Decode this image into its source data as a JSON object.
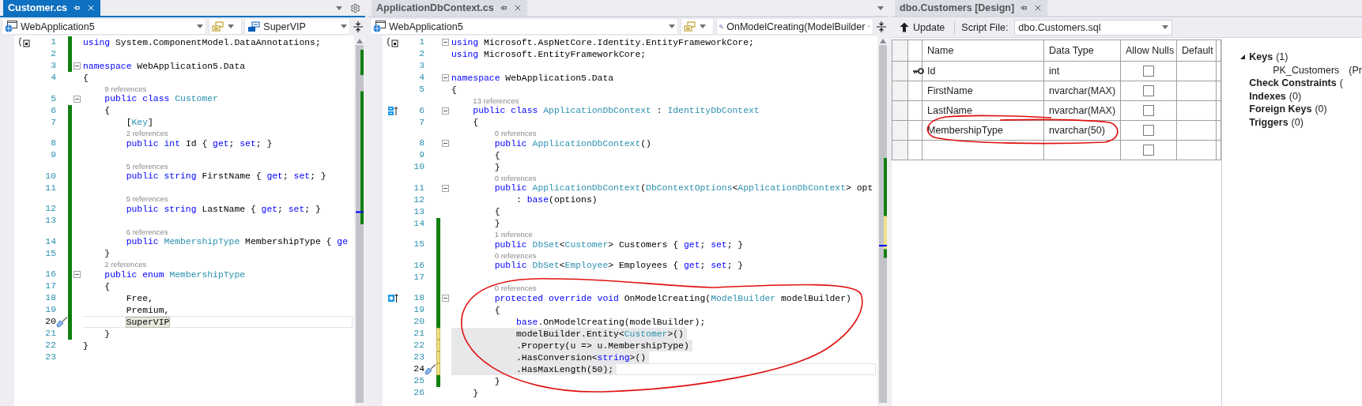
{
  "panels": [
    {
      "kind": "code",
      "tab": {
        "label": "Customer.cs",
        "selected": true
      },
      "nav": {
        "project": "WebApplication5",
        "member": {
          "text": "SuperVIP",
          "kind": "enum-value"
        }
      },
      "lines": [
        {
          "n": "1",
          "margin_icon": {
            "kind": "scope"
          },
          "changed": true,
          "saved": true,
          "code": [
            {
              "kind": "keyword",
              "text": "using"
            },
            {
              "kind": "plain",
              "text": " System.ComponentModel.DataAnnotations;"
            }
          ]
        },
        {
          "n": "2",
          "changed": true,
          "saved": true
        },
        {
          "n": "3",
          "changed": true,
          "saved": true,
          "fold": true,
          "code": [
            {
              "kind": "keyword",
              "text": "namespace"
            },
            {
              "kind": "plain",
              "text": " WebApplication5.Data"
            }
          ]
        },
        {
          "n": "4",
          "changed": false,
          "code": [
            {
              "kind": "plain",
              "text": "{"
            }
          ]
        },
        {
          "n": "5",
          "changed": false,
          "lens": "9 references",
          "fold": true,
          "code": [
            {
              "kind": "keyword",
              "text": "    public class "
            },
            {
              "kind": "type",
              "text": "Customer"
            }
          ]
        },
        {
          "n": "6",
          "changed": true,
          "saved": true,
          "code": [
            {
              "kind": "plain",
              "text": "    {"
            }
          ]
        },
        {
          "n": "7",
          "changed": true,
          "saved": true,
          "code": [
            {
              "kind": "plain",
              "text": "        ["
            },
            {
              "kind": "type",
              "text": "Key"
            },
            {
              "kind": "plain",
              "text": "]"
            }
          ]
        },
        {
          "n": "8",
          "changed": true,
          "saved": true,
          "lens": "2 references",
          "code": [
            {
              "kind": "keyword",
              "text": "        public int"
            },
            {
              "kind": "plain",
              "text": " Id { "
            },
            {
              "kind": "keyword",
              "text": "get"
            },
            {
              "kind": "plain",
              "text": "; "
            },
            {
              "kind": "keyword",
              "text": "set"
            },
            {
              "kind": "plain",
              "text": "; }"
            }
          ]
        },
        {
          "n": "9",
          "changed": true,
          "saved": true
        },
        {
          "n": "10",
          "changed": true,
          "saved": true,
          "lens": "5 references",
          "code": [
            {
              "kind": "keyword",
              "text": "        public string"
            },
            {
              "kind": "plain",
              "text": " FirstName { "
            },
            {
              "kind": "keyword",
              "text": "get"
            },
            {
              "kind": "plain",
              "text": "; "
            },
            {
              "kind": "keyword",
              "text": "set"
            },
            {
              "kind": "plain",
              "text": "; }"
            }
          ]
        },
        {
          "n": "11",
          "changed": true,
          "saved": true
        },
        {
          "n": "12",
          "changed": true,
          "saved": true,
          "lens": "5 references",
          "code": [
            {
              "kind": "keyword",
              "text": "        public string"
            },
            {
              "kind": "plain",
              "text": " LastName { "
            },
            {
              "kind": "keyword",
              "text": "get"
            },
            {
              "kind": "plain",
              "text": "; "
            },
            {
              "kind": "keyword",
              "text": "set"
            },
            {
              "kind": "plain",
              "text": "; }"
            }
          ]
        },
        {
          "n": "13",
          "changed": true,
          "saved": true
        },
        {
          "n": "14",
          "changed": true,
          "saved": true,
          "lens": "6 references",
          "code": [
            {
              "kind": "keyword",
              "text": "        public "
            },
            {
              "kind": "type",
              "text": "MembershipType"
            },
            {
              "kind": "plain",
              "text": " MembershipType { "
            },
            {
              "kind": "keyword",
              "text": "ge"
            }
          ]
        },
        {
          "n": "15",
          "changed": true,
          "saved": true,
          "code": [
            {
              "kind": "plain",
              "text": "    }"
            }
          ]
        },
        {
          "n": "16",
          "changed": true,
          "saved": true,
          "lens": "2 references",
          "fold": true,
          "code": [
            {
              "kind": "keyword",
              "text": "    public enum "
            },
            {
              "kind": "type",
              "text": "MembershipType"
            }
          ]
        },
        {
          "n": "17",
          "changed": true,
          "saved": true,
          "code": [
            {
              "kind": "plain",
              "text": "    {"
            }
          ]
        },
        {
          "n": "18",
          "changed": true,
          "saved": true,
          "code": [
            {
              "kind": "plain",
              "text": "        Free,"
            }
          ]
        },
        {
          "n": "19",
          "changed": true,
          "saved": true,
          "code": [
            {
              "kind": "plain",
              "text": "        Premium,"
            }
          ]
        },
        {
          "n": "20",
          "changed": true,
          "saved": true,
          "current": true,
          "margin_icon": {
            "kind": "quick-fix"
          },
          "code": [
            {
              "kind": "reference-highlight",
              "text": "        SuperVIP"
            }
          ]
        },
        {
          "n": "21",
          "changed": true,
          "saved": true,
          "code": [
            {
              "kind": "plain",
              "text": "    }"
            }
          ]
        },
        {
          "n": "22",
          "changed": false,
          "code": [
            {
              "kind": "plain",
              "text": "}"
            }
          ]
        },
        {
          "n": "23",
          "changed": false
        }
      ]
    },
    {
      "kind": "code",
      "tab": {
        "label": "ApplicationDbContext.cs",
        "selected": false
      },
      "nav": {
        "project": "WebApplication5",
        "member": {
          "text": "OnModelCreating(ModelBuilder",
          "kind": "method"
        }
      },
      "lines": [
        {
          "n": "1",
          "changed": false,
          "margin_icon": {
            "kind": "scope"
          },
          "fold": true,
          "code": [
            {
              "kind": "keyword",
              "text": "using"
            },
            {
              "kind": "plain",
              "text": " Microsoft.AspNetCore.Identity.EntityFrameworkCore;"
            }
          ]
        },
        {
          "n": "2",
          "changed": false,
          "code": [
            {
              "kind": "keyword",
              "text": "using"
            },
            {
              "kind": "plain",
              "text": " Microsoft.EntityFrameworkCore;"
            }
          ]
        },
        {
          "n": "3",
          "changed": false
        },
        {
          "n": "4",
          "changed": false,
          "fold": true,
          "code": [
            {
              "kind": "keyword",
              "text": "namespace"
            },
            {
              "kind": "plain",
              "text": " WebApplication5.Data"
            }
          ]
        },
        {
          "n": "5",
          "changed": false,
          "code": [
            {
              "kind": "plain",
              "text": "{"
            }
          ]
        },
        {
          "n": "6",
          "changed": false,
          "lens": "13 references",
          "margin_icon": {
            "kind": "implements"
          },
          "fold": true,
          "code": [
            {
              "kind": "keyword",
              "text": "    public class "
            },
            {
              "kind": "type",
              "text": "ApplicationDbContext"
            },
            {
              "kind": "plain",
              "text": " : "
            },
            {
              "kind": "type",
              "text": "IdentityDbContext"
            }
          ]
        },
        {
          "n": "7",
          "changed": false,
          "code": [
            {
              "kind": "plain",
              "text": "    {"
            }
          ]
        },
        {
          "n": "8",
          "changed": false,
          "lens": "0 references",
          "fold": true,
          "code": [
            {
              "kind": "keyword",
              "text": "        public "
            },
            {
              "kind": "type",
              "text": "ApplicationDbContext"
            },
            {
              "kind": "plain",
              "text": "()"
            }
          ]
        },
        {
          "n": "9",
          "changed": false,
          "code": [
            {
              "kind": "plain",
              "text": "        {"
            }
          ]
        },
        {
          "n": "10",
          "changed": false,
          "code": [
            {
              "kind": "plain",
              "text": "        }"
            }
          ]
        },
        {
          "n": "11",
          "changed": false,
          "lens": "0 references",
          "fold": true,
          "code": [
            {
              "kind": "keyword",
              "text": "        public "
            },
            {
              "kind": "type",
              "text": "ApplicationDbContext"
            },
            {
              "kind": "plain",
              "text": "("
            },
            {
              "kind": "type",
              "text": "DbContextOptions"
            },
            {
              "kind": "plain",
              "text": "<"
            },
            {
              "kind": "type",
              "text": "ApplicationDbContext"
            },
            {
              "kind": "plain",
              "text": "> opt"
            }
          ]
        },
        {
          "n": "12",
          "changed": false,
          "code": [
            {
              "kind": "plain",
              "text": "            : "
            },
            {
              "kind": "keyword",
              "text": "base"
            },
            {
              "kind": "plain",
              "text": "(options)"
            }
          ]
        },
        {
          "n": "13",
          "changed": false,
          "code": [
            {
              "kind": "plain",
              "text": "        {"
            }
          ]
        },
        {
          "n": "14",
          "changed": true,
          "saved": true,
          "code": [
            {
              "kind": "plain",
              "text": "        }"
            }
          ]
        },
        {
          "n": "15",
          "changed": true,
          "saved": true,
          "lens": "1 reference",
          "code": [
            {
              "kind": "keyword",
              "text": "        public "
            },
            {
              "kind": "type",
              "text": "DbSet"
            },
            {
              "kind": "plain",
              "text": "<"
            },
            {
              "kind": "type",
              "text": "Customer"
            },
            {
              "kind": "plain",
              "text": "> Customers { "
            },
            {
              "kind": "keyword",
              "text": "get"
            },
            {
              "kind": "plain",
              "text": "; "
            },
            {
              "kind": "keyword",
              "text": "set"
            },
            {
              "kind": "plain",
              "text": "; }"
            }
          ]
        },
        {
          "n": "16",
          "changed": true,
          "saved": true,
          "lens": "0 references",
          "code": [
            {
              "kind": "keyword",
              "text": "        public "
            },
            {
              "kind": "type",
              "text": "DbSet"
            },
            {
              "kind": "plain",
              "text": "<"
            },
            {
              "kind": "type",
              "text": "Employee"
            },
            {
              "kind": "plain",
              "text": "> Employees { "
            },
            {
              "kind": "keyword",
              "text": "get"
            },
            {
              "kind": "plain",
              "text": "; "
            },
            {
              "kind": "keyword",
              "text": "set"
            },
            {
              "kind": "plain",
              "text": "; }"
            }
          ]
        },
        {
          "n": "17",
          "changed": true,
          "saved": true
        },
        {
          "n": "18",
          "changed": true,
          "saved": true,
          "lens": "0 references",
          "margin_icon": {
            "kind": "override"
          },
          "fold": true,
          "code": [
            {
              "kind": "keyword",
              "text": "        protected override void"
            },
            {
              "kind": "plain",
              "text": " OnModelCreating("
            },
            {
              "kind": "type",
              "text": "ModelBuilder"
            },
            {
              "kind": "plain",
              "text": " modelBuilder)"
            }
          ]
        },
        {
          "n": "19",
          "changed": true,
          "saved": true,
          "code": [
            {
              "kind": "plain",
              "text": "        {"
            }
          ]
        },
        {
          "n": "20",
          "changed": true,
          "saved": true,
          "code": [
            {
              "kind": "keyword",
              "text": "            base"
            },
            {
              "kind": "plain",
              "text": ".OnModelCreating(modelBuilder);"
            }
          ]
        },
        {
          "n": "21",
          "changed": true,
          "saved": false,
          "highlight": true,
          "code": [
            {
              "kind": "plain",
              "text": "            modelBuilder.Entity<"
            },
            {
              "kind": "type",
              "text": "Customer"
            },
            {
              "kind": "plain",
              "text": ">()"
            }
          ]
        },
        {
          "n": "22",
          "changed": true,
          "saved": false,
          "highlight": true,
          "code": [
            {
              "kind": "plain",
              "text": "            .Property(u => u.MembershipType)"
            }
          ]
        },
        {
          "n": "23",
          "changed": true,
          "saved": false,
          "highlight": true,
          "code": [
            {
              "kind": "plain",
              "text": "            .HasConversion<"
            },
            {
              "kind": "keyword",
              "text": "string"
            },
            {
              "kind": "plain",
              "text": ">()"
            }
          ]
        },
        {
          "n": "24",
          "changed": true,
          "saved": false,
          "highlight": true,
          "current": true,
          "margin_icon": {
            "kind": "quick-fix"
          },
          "code": [
            {
              "kind": "plain",
              "text": "            .HasMaxLength(50);"
            }
          ]
        },
        {
          "n": "25",
          "changed": true,
          "saved": true,
          "code": [
            {
              "kind": "plain",
              "text": "        }"
            }
          ]
        },
        {
          "n": "26",
          "changed": false,
          "code": [
            {
              "kind": "plain",
              "text": "    }"
            }
          ]
        }
      ]
    },
    {
      "kind": "designer",
      "tab": {
        "label": "dbo.Customers [Design]",
        "selected": false
      },
      "toolbar": {
        "button": "Update",
        "script_label": "Script File:",
        "script_file": "dbo.Customers.sql"
      },
      "columns": [
        "Name",
        "Data Type",
        "Allow Nulls",
        "Default"
      ],
      "rows": [
        {
          "name": "Id",
          "data_type": "int",
          "key": true,
          "allow_nulls": false
        },
        {
          "name": "FirstName",
          "data_type": "nvarchar(MAX)",
          "key": false,
          "allow_nulls": false
        },
        {
          "name": "LastName",
          "data_type": "nvarchar(MAX)",
          "key": false,
          "allow_nulls": false
        },
        {
          "name": "MembershipType",
          "data_type": "nvarchar(50)",
          "key": false,
          "allow_nulls": false
        },
        {
          "key": false,
          "allow_nulls": false
        }
      ],
      "tree": [
        {
          "label": "Keys",
          "count": "(1)",
          "expanded": true,
          "children": [
            {
              "label": "PK_Customers",
              "count": "(Pr"
            }
          ]
        },
        {
          "label": "Check Constraints",
          "count": "("
        },
        {
          "label": "Indexes",
          "count": "(0)"
        },
        {
          "label": "Foreign Keys",
          "count": "(0)"
        },
        {
          "label": "Triggers",
          "count": "(0)"
        }
      ]
    }
  ]
}
